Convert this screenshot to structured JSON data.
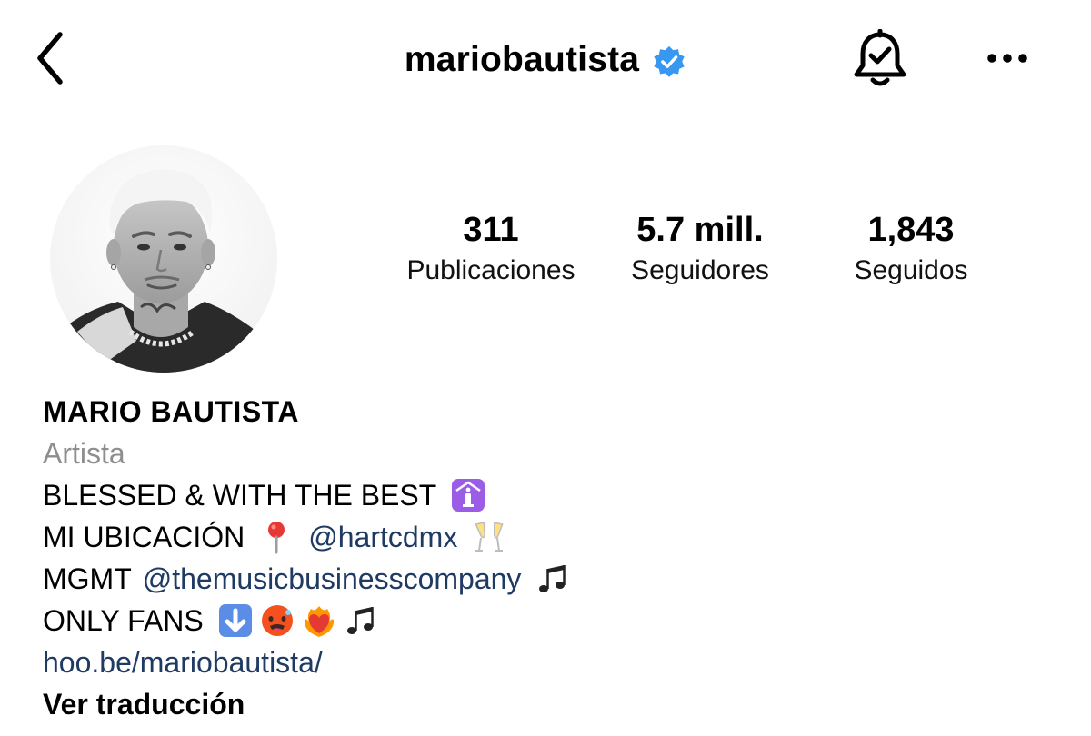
{
  "header": {
    "username": "mariobautista",
    "verified": true,
    "icons": {
      "back": "chevron-left-icon",
      "verified": "verified-badge-icon",
      "notifications": "bell-check-icon",
      "more": "more-horizontal-icon"
    }
  },
  "profile": {
    "avatar": "avatar",
    "stats": [
      {
        "value": "311",
        "label": "Publicaciones"
      },
      {
        "value": "5.7 mill.",
        "label": "Seguidores"
      },
      {
        "value": "1,843",
        "label": "Seguidos"
      }
    ]
  },
  "bio": {
    "name": "MARIO BAUTISTA",
    "category": "Artista",
    "line1": "BLESSED & WITH THE BEST",
    "line2_prefix": "MI UBICACIÓN",
    "line2_mention": "@hartcdmx",
    "line3_prefix": "MGMT",
    "line3_mention": "@themusicbusinesscompany",
    "line4_prefix": "ONLY FANS",
    "link": "hoo.be/mariobautista/",
    "translate": "Ver traducción"
  },
  "colors": {
    "accent_link": "#1f3a63",
    "verified_blue": "#3897f0",
    "secondary_text": "#8e8e8e",
    "emoji_purple": "#9b5de5"
  }
}
